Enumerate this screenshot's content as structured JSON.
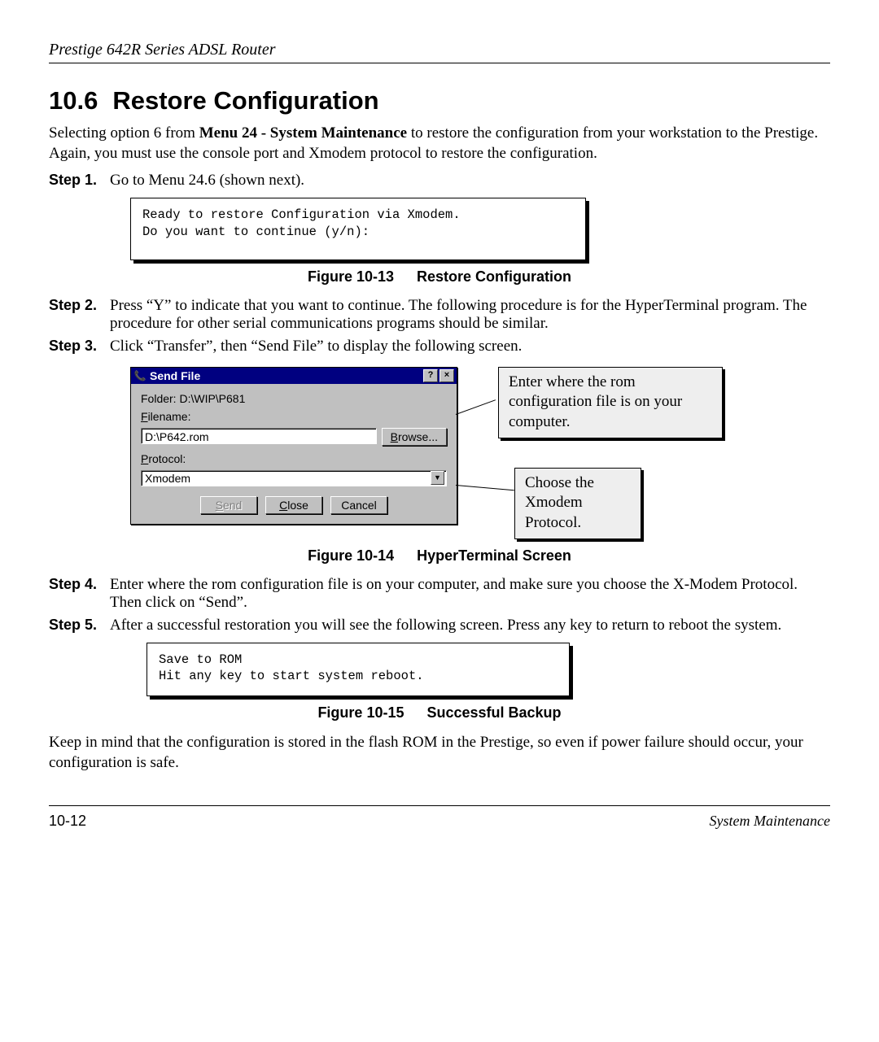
{
  "header": {
    "running": "Prestige 642R Series ADSL Router"
  },
  "section": {
    "number": "10.6",
    "title": "Restore Configuration",
    "intro_before_bold": "Selecting option 6 from ",
    "intro_bold": "Menu 24 - System Maintenance",
    "intro_after_bold": " to restore the configuration from your workstation to the Prestige. Again, you must use the console port and Xmodem protocol to restore the configuration."
  },
  "steps": {
    "s1_label": "Step 1.",
    "s1_body": "Go to Menu 24.6 (shown next).",
    "s2_label": "Step 2.",
    "s2_body": "Press “Y” to indicate that you want to continue. The following procedure is for the HyperTerminal program. The procedure for other serial communications programs should be similar.",
    "s3_label": "Step 3.",
    "s3_body": "Click “Transfer”, then “Send File” to display the following screen.",
    "s4_label": "Step 4.",
    "s4_body": "Enter where the rom configuration file is on your computer, and make sure you choose the X-Modem Protocol. Then click on “Send”.",
    "s5_label": "Step 5.",
    "s5_body": "After a successful restoration you will see the following screen. Press any key to return to reboot the system."
  },
  "terminal1": "Ready to restore Configuration via Xmodem.\nDo you want to continue (y/n):",
  "fig13_num": "Figure 10-13",
  "fig13_title": "Restore Configuration",
  "dialog": {
    "title": "Send File",
    "help_btn": "?",
    "close_btn": "×",
    "folder_label": "Folder: D:\\WIP\\P681",
    "filename_label_pre": "F",
    "filename_label_post": "ilename:",
    "filename_value": "D:\\P642.rom",
    "browse_pre": "B",
    "browse_post": "rowse...",
    "protocol_label_pre": "P",
    "protocol_label_post": "rotocol:",
    "protocol_value": "Xmodem",
    "send_pre": "S",
    "send_post": "end",
    "close_pre": "C",
    "close_post": "lose",
    "cancel": "Cancel"
  },
  "callouts": {
    "c1": "Enter where the rom configuration file is on your computer.",
    "c2": "Choose the Xmodem Protocol."
  },
  "fig14_num": "Figure 10-14",
  "fig14_title": "HyperTerminal Screen",
  "terminal2": "Save to ROM\nHit any key to start system reboot.",
  "fig15_num": "Figure 10-15",
  "fig15_title": "Successful Backup",
  "closing_para": "Keep in mind that the configuration is stored in the flash ROM in the Prestige, so even if power failure should occur, your configuration is safe.",
  "footer": {
    "page": "10-12",
    "section": "System Maintenance"
  }
}
